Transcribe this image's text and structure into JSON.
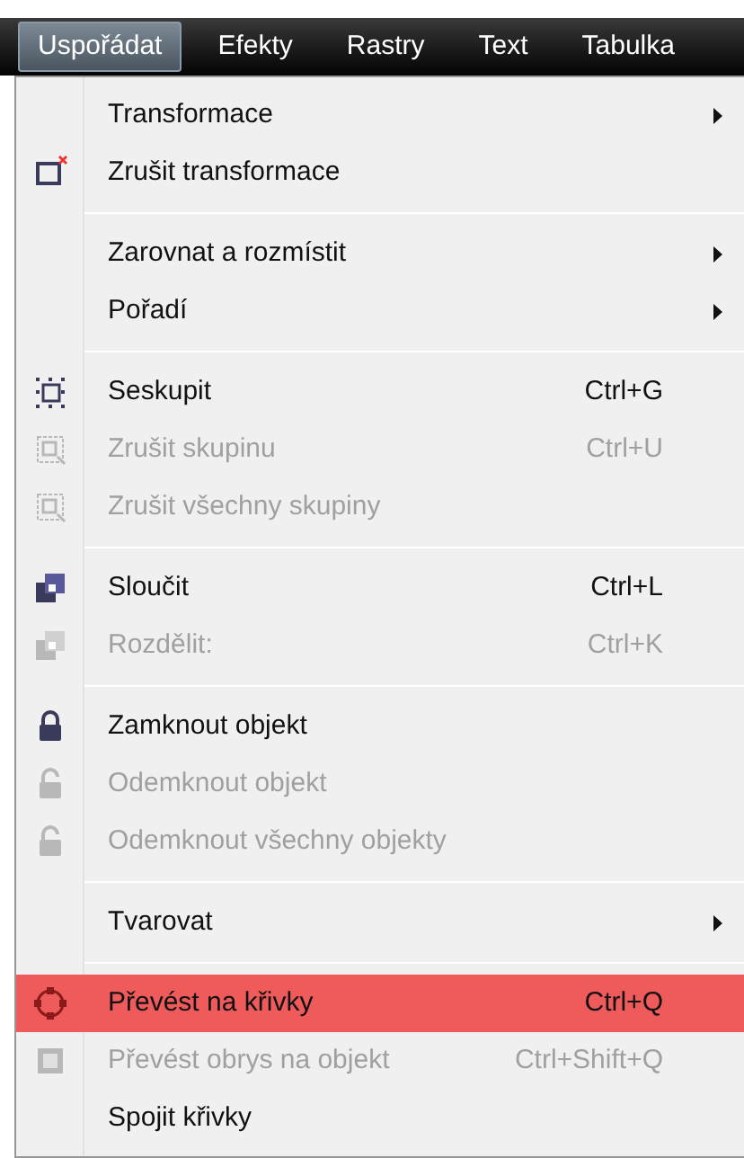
{
  "menubar": [
    {
      "label": "Uspořádat",
      "selected": true
    },
    {
      "label": "Efekty",
      "selected": false
    },
    {
      "label": "Rastry",
      "selected": false
    },
    {
      "label": "Text",
      "selected": false
    },
    {
      "label": "Tabulka",
      "selected": false
    }
  ],
  "menu": [
    {
      "kind": "item",
      "label": "Transformace",
      "submenu": true,
      "disabled": false,
      "selected": false
    },
    {
      "kind": "item",
      "label": "Zrušit transformace",
      "disabled": false,
      "selected": false
    },
    {
      "kind": "separator"
    },
    {
      "kind": "item",
      "label": "Zarovnat a rozmístit",
      "submenu": true,
      "disabled": false,
      "selected": false
    },
    {
      "kind": "item",
      "label": "Pořadí",
      "submenu": true,
      "disabled": false,
      "selected": false
    },
    {
      "kind": "separator"
    },
    {
      "kind": "item",
      "label": "Seskupit",
      "shortcut": "Ctrl+G",
      "disabled": false,
      "selected": false
    },
    {
      "kind": "item",
      "label": "Zrušit skupinu",
      "shortcut": "Ctrl+U",
      "disabled": true,
      "selected": false
    },
    {
      "kind": "item",
      "label": "Zrušit všechny skupiny",
      "disabled": true,
      "selected": false
    },
    {
      "kind": "separator"
    },
    {
      "kind": "item",
      "label": "Sloučit",
      "shortcut": "Ctrl+L",
      "disabled": false,
      "selected": false
    },
    {
      "kind": "item",
      "label": "Rozdělit:",
      "shortcut": "Ctrl+K",
      "disabled": true,
      "selected": false
    },
    {
      "kind": "separator"
    },
    {
      "kind": "item",
      "label": "Zamknout objekt",
      "disabled": false,
      "selected": false
    },
    {
      "kind": "item",
      "label": "Odemknout objekt",
      "disabled": true,
      "selected": false
    },
    {
      "kind": "item",
      "label": "Odemknout všechny objekty",
      "disabled": true,
      "selected": false
    },
    {
      "kind": "separator"
    },
    {
      "kind": "item",
      "label": "Tvarovat",
      "submenu": true,
      "disabled": false,
      "selected": false
    },
    {
      "kind": "separator"
    },
    {
      "kind": "item",
      "label": "Převést na křivky",
      "shortcut": "Ctrl+Q",
      "disabled": false,
      "selected": true
    },
    {
      "kind": "item",
      "label": "Převést obrys na objekt",
      "shortcut": "Ctrl+Shift+Q",
      "disabled": true,
      "selected": false
    },
    {
      "kind": "item",
      "label": "Spojit křivky",
      "disabled": false,
      "selected": false
    }
  ]
}
